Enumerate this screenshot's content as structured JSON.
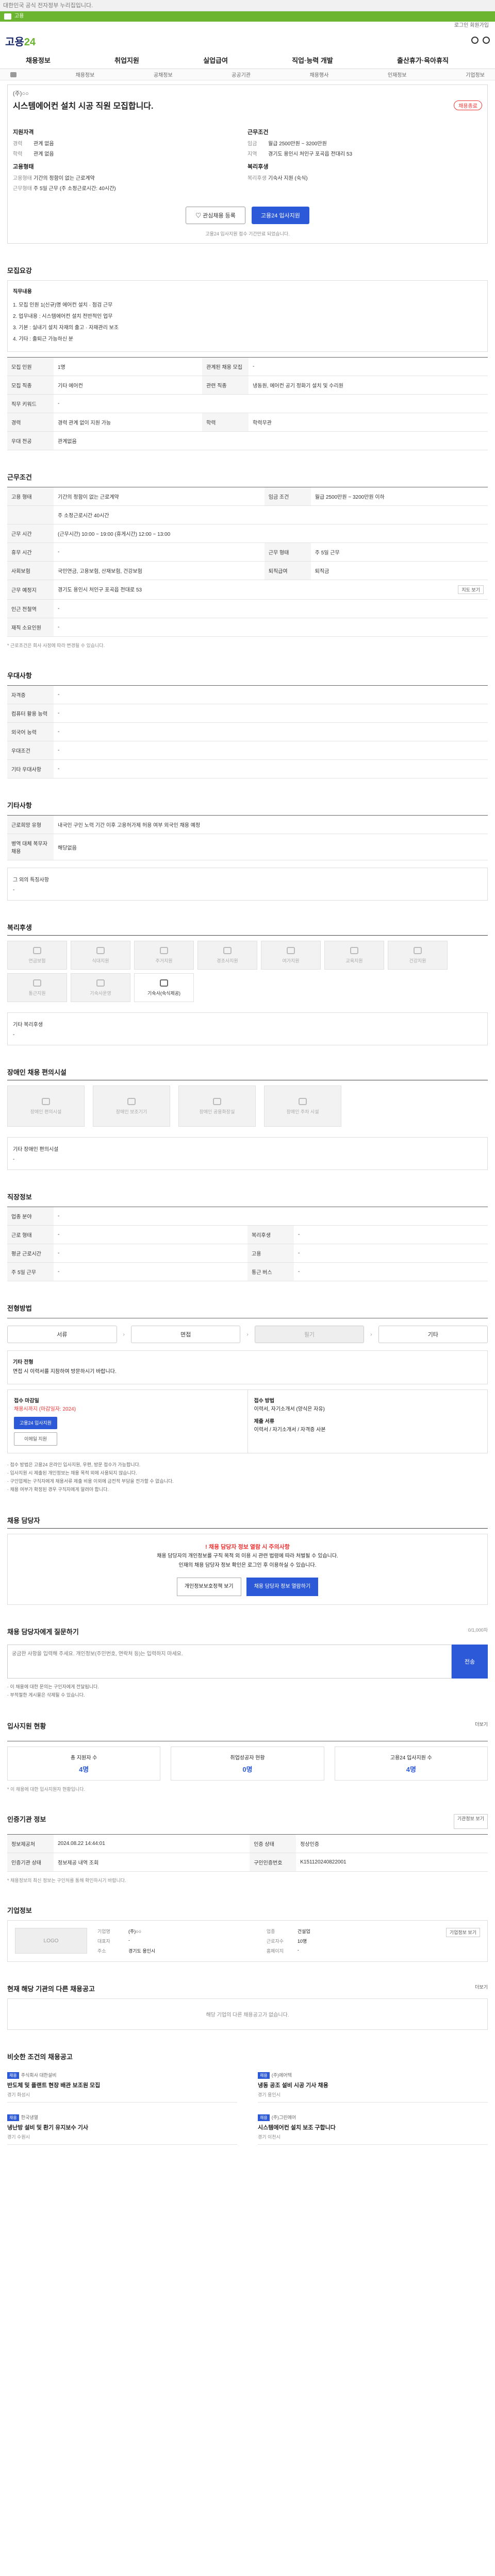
{
  "top_notice": "대한민국 공식 전자정부 누리집입니다.",
  "gov_bar": "고용",
  "util_text": "로그인 회원가입",
  "logo": {
    "main": "고용",
    "sub": "24"
  },
  "gnb": [
    "채용정보",
    "취업지원",
    "실업급여",
    "직업·능력 개발",
    "출산휴가·육아휴직"
  ],
  "sub_gnb": [
    "채용정보",
    "공채정보",
    "공공기관",
    "채용행사",
    "인재정보",
    "기업정보"
  ],
  "job": {
    "company": "(주)○○",
    "title": "시스템에어컨 설치 시공 직원 모집합니다.",
    "badge": "채용종료",
    "summary_left_head": "지원자격",
    "summary_left": [
      [
        "경력",
        "관계 없음"
      ],
      [
        "학력",
        "관계 없음"
      ]
    ],
    "summary_right_head": "근무조건",
    "summary_right": [
      [
        "임금",
        "월급 2500만원 ~ 3200만원"
      ],
      [
        "지역",
        "경기도 용인시 처인구 포곡읍 전대리 53"
      ]
    ],
    "summary_left2_head": "고용형태",
    "summary_left2": [
      [
        "고용형태",
        "기간의 정함이 없는 근로계약"
      ],
      [
        "근무형태",
        "주 5일 근무 (주 소정근로시간: 40시간)"
      ]
    ],
    "summary_right2_head": "복리후생",
    "summary_right2": [
      [
        "복리후생",
        "기숙사 지원 (숙식)"
      ]
    ],
    "btn_scrap": "♡ 관심채용 등록",
    "btn_apply": "고용24 입사지원",
    "fine": "고용24 입사지원 접수 기간만료 되었습니다."
  },
  "sec_recruit": {
    "title": "모집요강",
    "duty_head": "직무내용",
    "duties": [
      "1. 모집 인원 1(신규)명 에어컨 설치 · 점검 근무",
      "2. 업무내용 : 시스템에어컨 설치 전반적인 업무",
      "3. 기본 : 실내기 설치 자재의 출고 · 자재관리 보조",
      "4. 기타 : 출퇴근 가능하신 분"
    ],
    "rows": [
      [
        "모집 인원",
        "1명",
        "관계된 채용 모집",
        "-"
      ],
      [
        "모집 직종",
        "기타 에어컨",
        "관련 직종",
        "냉동원, 에어컨 공기 정화기 설치 및 수리원"
      ],
      [
        "직무 키워드",
        "-",
        "",
        ""
      ],
      [
        "경력",
        "경력 관계 없이 지원 가능",
        "학력",
        "학력무관"
      ],
      [
        "우대 전공",
        "관계없음",
        "",
        ""
      ]
    ]
  },
  "sec_cond": {
    "title": "근무조건",
    "rows": [
      [
        "고용 형태",
        "기간의 정함이 없는 근로계약",
        "임금 조건",
        "월급 2500만원 ~ 3200만원 이하"
      ],
      [
        "",
        "주 소정근로시간 40시간",
        "",
        ""
      ],
      [
        "근무 시간",
        "(근무시간) 10:00 ~ 19:00 (휴게시간) 12:00 ~ 13:00",
        "",
        ""
      ],
      [
        "휴무 시간",
        "-",
        "근무 형태",
        "주 5일 근무"
      ],
      [
        "사회보험",
        "국민연금, 고용보험, 산재보험, 건강보험",
        "퇴직급여",
        "퇴직금"
      ],
      [
        "근무 예정지",
        "경기도 용인시 처인구 포곡읍 전대로 53",
        "",
        "지도 보기"
      ],
      [
        "인근 전철역",
        "-",
        "",
        ""
      ],
      [
        "재직 소요인원",
        "-",
        "",
        ""
      ]
    ],
    "note": "* 근로조건은 회사 사정에 따라 변경될 수 있습니다."
  },
  "sec_pref": {
    "title": "우대사항",
    "rows": [
      [
        "자격증",
        "-"
      ],
      [
        "컴퓨터 활용 능력",
        "-"
      ],
      [
        "외국어 능력",
        "-"
      ],
      [
        "우대조건",
        "-"
      ],
      [
        "기타 우대사항",
        "-"
      ]
    ]
  },
  "sec_other": {
    "title": "기타사항",
    "rows": [
      [
        "근로희망 유형",
        "내국인 구인 노력 기간 이후 고용허가제 허용 여부 외국인 채용 예정"
      ],
      [
        "병역 대체 복무자 채용",
        "해당없음"
      ]
    ],
    "etc_head": "그 외의 특징사항",
    "etc": "-"
  },
  "sec_welfare": {
    "title": "복리후생",
    "items": [
      "연금보험",
      "식대지원",
      "주거지원",
      "경조사지원",
      "여가지원",
      "교육지원",
      "건강지원",
      "통근지원",
      "기숙사운영",
      "기숙사(숙식제공)"
    ],
    "other_head": "기타 복리후생",
    "other": "-"
  },
  "sec_disability": {
    "title": "장애인 채용 편의시설",
    "items": [
      "장애인 편의시설",
      "장애인 보조기기",
      "장애인 공용화장실",
      "장애인 주차 시설"
    ],
    "other_head": "기타 장애인 편의시설",
    "other": "-"
  },
  "sec_company_info": {
    "title": "직장정보",
    "rows": [
      [
        "업종 분야",
        "-",
        "",
        ""
      ],
      [
        "근로 형태",
        "-",
        "복리후생",
        "-"
      ],
      [
        "평균 근로시간",
        "-",
        "고용",
        "-"
      ],
      [
        "주 5일 근무",
        "-",
        "통근 버스",
        "-"
      ]
    ]
  },
  "sec_process": {
    "title": "전형방법",
    "steps": [
      "서류",
      "면접",
      "필기",
      "기타"
    ],
    "etc_head": "기타 전형",
    "etc": "면접 시 이력서를 지참하여 방문하시기 바랍니다.",
    "apply_head": "접수 마감일",
    "apply_date": "채용시까지 (마감일자: 2024)",
    "apply_btn": "고용24 입사지원",
    "email_btn": "이메일 지원",
    "method_head": "접수 방법",
    "method": "이력서, 자기소개서 (양식은 자유)",
    "doc_head": "제출 서류",
    "doc": "이력서 / 자기소개서 / 자격증 사본",
    "bullets": [
      "· 접수 방법은 고용24 온라인 입사지원, 우편, 방문 접수가 가능합니다.",
      "· 입사지원 시 제출된 개인정보는 채용 목적 외에 사용되지 않습니다.",
      "· 구인업체는 구직자에게 채용서류 제출 비용 이외에 금전적 부담을 전가할 수 없습니다.",
      "· 채용 여부가 확정된 경우 구직자에게 알려야 합니다."
    ]
  },
  "sec_contact": {
    "title": "채용 담당자",
    "alert": "! 채용 담당자 정보 열람 시 주의사항",
    "lines": [
      "채용 담당자의 개인정보를 구직 목적 외 이용 시 관련 법령에 따라 처벌될 수 있습니다.",
      "인재의 채용 담당자 정보 확인은 로그인 후 이용하실 수 있습니다."
    ],
    "btn1": "개인정보보호정책 보기",
    "btn2": "채용 담당자 정보 열람하기"
  },
  "sec_qna": {
    "title": "채용 담당자에게 질문하기",
    "hint": "0/1,000자",
    "placeholder": "궁금한 사항을 입력해 주세요. 개인정보(주민번호, 연락처 등)는 입력하지 마세요.",
    "send": "전송",
    "notes": [
      "· 이 채용에 대한 문의는 구인자에게 전달됩니다.",
      "· 부적절한 게시물은 삭제될 수 있습니다."
    ]
  },
  "sec_stats": {
    "title": "입사지원 현황",
    "link": "더보기",
    "items": [
      [
        "총 지원자 수",
        "4명"
      ],
      [
        "취업성공자 현황",
        "0명"
      ],
      [
        "고용24 입사지원 수",
        "4명"
      ]
    ],
    "note": "* 이 채용에 대한 입사지원자 현황입니다."
  },
  "sec_reg": {
    "title": "인증기관 정보",
    "btn": "기관정보 보기",
    "rows": [
      [
        "정보제공처",
        "2024.08.22 14:44:01",
        "인증 상태",
        "정상인증"
      ],
      [
        "인증기관 상태",
        "정보제공 내역 조회",
        "구인인증번호",
        "K151120240822001"
      ]
    ],
    "note": "* 채용정보의 최신 정보는 구인처를 통해 확인하시기 바랍니다."
  },
  "sec_corp": {
    "title": "기업정보",
    "logo": "LOGO",
    "btn": "기업정보 보기",
    "info": [
      [
        "기업명",
        "(주)○○",
        "업종",
        "건설업"
      ],
      [
        "대표자",
        "-",
        "근로자수",
        "10명"
      ],
      [
        "주소",
        "경기도 용인시",
        "홈페이지",
        "-"
      ]
    ]
  },
  "sec_ending": {
    "title": "현재 해당 기관의 다른 채용공고",
    "link": "더보기",
    "empty": "해당 기업의 다른 채용공고가 없습니다."
  },
  "sec_similar": {
    "title": "비슷한 조건의 채용공고",
    "cards": [
      {
        "tag": "채용",
        "co": "주식회사 대한설비",
        "t": "반도체 및 플랜트 현장 배관 보조원 모집",
        "m": "경기 화성시"
      },
      {
        "tag": "채용",
        "co": "(주)에어텍",
        "t": "냉동 공조 설비 시공 기사 채용",
        "m": "경기 용인시"
      },
      {
        "tag": "채용",
        "co": "한국냉열",
        "t": "냉난방 설비 및 환기 유지보수 기사",
        "m": "경기 수원시"
      },
      {
        "tag": "채용",
        "co": "(주)그린에어",
        "t": "시스템에어컨 설치 보조 구합니다",
        "m": "경기 이천시"
      }
    ]
  }
}
